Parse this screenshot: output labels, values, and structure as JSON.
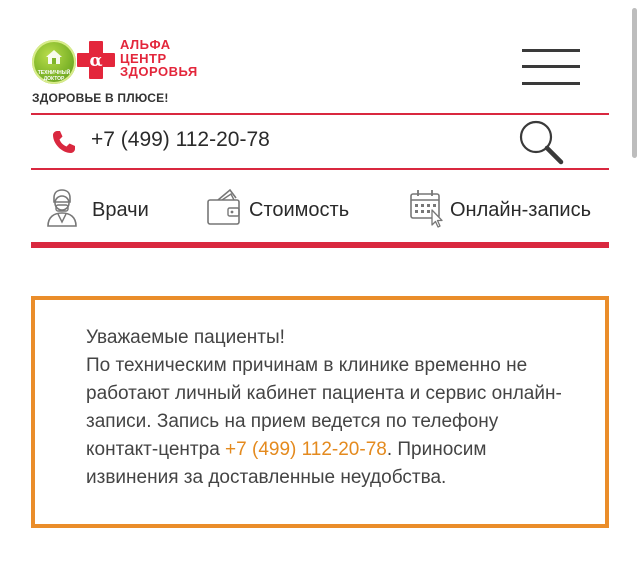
{
  "brand": {
    "badge_text": "ТЕХНИЧНЫЙ ДОКТОР",
    "name_line1": "АЛЬФА",
    "name_line2": "ЦЕНТР",
    "name_line3": "ЗДОРОВЬЯ",
    "cross_letter": "α",
    "tagline": "ЗДОРОВЬЕ В ПЛЮСЕ!",
    "colors": {
      "primary_red": "#d9283f",
      "logo_green": "#7fb52a",
      "notice_orange": "#ea8d2a"
    }
  },
  "header": {
    "menu_icon": "hamburger-menu-icon"
  },
  "contact": {
    "phone": "+7 (499) 112-20-78",
    "phone_icon": "phone-icon",
    "search_icon": "search-icon"
  },
  "nav": {
    "items": [
      {
        "label": "Врачи",
        "icon": "doctor-icon"
      },
      {
        "label": "Стоимость",
        "icon": "wallet-icon"
      },
      {
        "label": "Онлайн-запись",
        "icon": "calendar-icon"
      }
    ]
  },
  "notice": {
    "line1": "Уважаемые пациенты!",
    "text_before_phone": "По техническим причинам в клинике временно не работают личный кабинет пациента и сервис онлайн-записи. Запись на прием ведется по телефону контакт-центра",
    "phone": "+7 (499) 112-20-78",
    "text_after_phone": ". Приносим извинения за доставленные неудобства."
  }
}
